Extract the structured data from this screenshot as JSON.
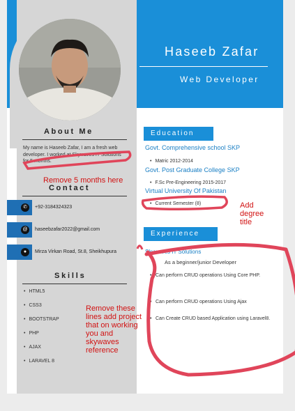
{
  "header": {
    "name": "Haseeb Zafar",
    "role": "Web Developer"
  },
  "about": {
    "title": "About Me",
    "text": "My name is Haseeb Zafar, I am a fresh web developer. I worked at Skywaves IT Solutions for 5 months."
  },
  "contact": {
    "title": "Contact",
    "phone": "+92-3184324323",
    "email": "haseebzafar2022@gmail.com",
    "address": "Mirza Virkan Road, St.8, Sheikhupura"
  },
  "skills": {
    "title": "Skills",
    "items": [
      "HTML5",
      "CSS3",
      "BOOTSTRAP",
      "PHP",
      "AJAX",
      "LARAVEL 8"
    ]
  },
  "education": {
    "title": "Education",
    "entries": [
      {
        "institution": "Govt. Comprehensive school SKP",
        "detail": "Matric 2012-2014"
      },
      {
        "institution": "Govt. Post Graduate College SKP",
        "detail": "F.Sc Pre-Engineering 2015-2017"
      },
      {
        "institution": "Virtual University Of Pakistan",
        "detail": "Current Semester (8)"
      }
    ]
  },
  "experience": {
    "title": "Experience",
    "company": "Skywaves IT Solutions",
    "role": "As a beginner/junior Developer",
    "items": [
      "Can perform CRUD operations Using Core PHP.",
      "Can perform CRUD operations Using Ajax",
      "Can Create CRUD based Application using Laravel8."
    ]
  },
  "annotations": {
    "remove_months": "Remove 5 months here",
    "add_degree": "Add degree title",
    "remove_lines": "Remove these lines add project that on working you and skywaves reference"
  },
  "colors": {
    "accent": "#1a8fd8",
    "sidebar": "#d6d6d6",
    "annotation": "#e0455a"
  },
  "icons": [
    "phone-icon",
    "email-icon",
    "location-icon"
  ]
}
